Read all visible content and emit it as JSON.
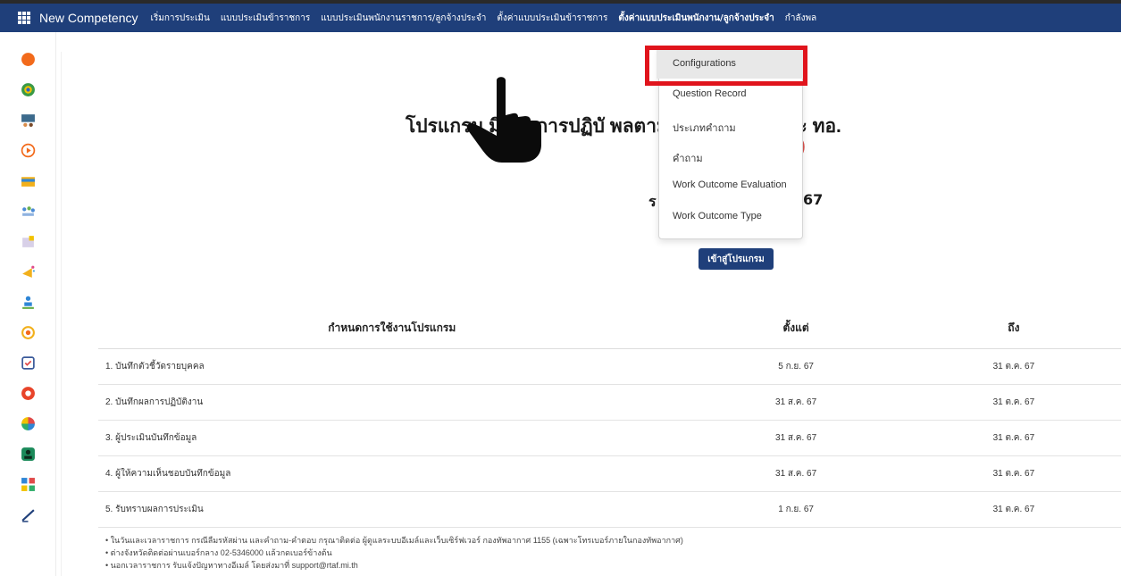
{
  "topbar": {
    "brand": "New Competency",
    "nav": [
      "เริ่มการประเมิน",
      "แบบประเมินข้าราชการ",
      "แบบประเมินพนักงานราชการ/ลูกจ้างประจำ",
      "ตั้งค่าแบบประเมินข้าราชการ",
      "ตั้งค่าแบบประเมินพนักงาน/ลูกจ้างประจำ",
      "กำลังพล"
    ]
  },
  "dropdown": {
    "items": [
      "Configurations",
      "Question Record",
      "ประเภทคำถาม",
      "คำถาม",
      "Work Outcome Evaluation",
      "Work Outcome Type"
    ]
  },
  "hero": {
    "title": "โปรแกรม          มินผลการปฏิบั                    พลตามแนวคิดสมรรถนะ ทอ.",
    "subtitle_fragment": ")",
    "round_fragment_left": "ร",
    "round_fragment_right": "67",
    "enter_button": "เข้าสู่โปรแกรม"
  },
  "schedule": {
    "headers": [
      "กำหนดการใช้งานโปรแกรม",
      "ตั้งแต่",
      "ถึง"
    ],
    "rows": [
      [
        "1. บันทึกตัวชี้วัดรายบุคคล",
        "5 ก.ย. 67",
        "31 ต.ค. 67"
      ],
      [
        "2. บันทึกผลการปฏิบัติงาน",
        "31 ส.ค. 67",
        "31 ต.ค. 67"
      ],
      [
        "3. ผู้ประเมินบันทึกข้อมูล",
        "31 ส.ค. 67",
        "31 ต.ค. 67"
      ],
      [
        "4. ผู้ให้ความเห็นชอบบันทึกข้อมูล",
        "31 ส.ค. 67",
        "31 ต.ค. 67"
      ],
      [
        "5. รับทราบผลการประเมิน",
        "1 ก.ย. 67",
        "31 ต.ค. 67"
      ]
    ]
  },
  "notes": [
    "ในวันและเวลาราชการ กรณีลืมรหัสผ่าน และคำถาม-คำตอบ กรุณาติดต่อ ผู้ดูแลระบบอีเมล์และเว็บเซิร์ฟเวอร์ กองทัพอากาศ 1155 (เฉพาะโทรเบอร์ภายในกองทัพอากาศ)",
    "ต่างจังหวัดติดต่อผ่านเบอร์กลาง 02-5346000 แล้วกดเบอร์ข้างต้น",
    "นอกเวลาราชการ รับแจ้งปัญหาทางอีเมล์ โดยส่งมาที่ support@rtaf.mi.th"
  ],
  "leftbar_icons": [
    "chat-bubble-icon",
    "chrome-like-icon",
    "presentation-icon",
    "play-circle-icon",
    "folder-icon",
    "people-icon",
    "document-icon",
    "megaphone-icon",
    "org-chart-icon",
    "support-icon",
    "calendar-check-icon",
    "office-icon",
    "pie-chart-icon",
    "contact-card-icon",
    "dashboard-icon",
    "pen-icon"
  ],
  "colors": {
    "nav_bg": "#1f3f7a",
    "highlight_border": "#e0141c",
    "accent_red": "#d9534f"
  }
}
